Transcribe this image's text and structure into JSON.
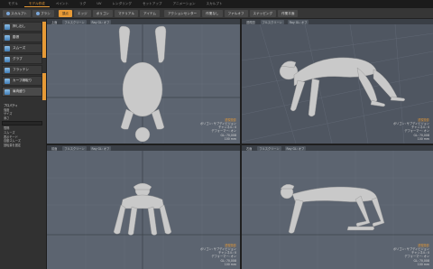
{
  "menubar": {
    "tabs": [
      "モデル",
      "モデル作成",
      "ペイント",
      "リグ",
      "UV",
      "レンダリング",
      "セットアップ",
      "アニメーション",
      "スカルプト"
    ],
    "active_index": 1
  },
  "toolbar": {
    "left_buttons": [
      "スカルプト",
      "ブラシ"
    ],
    "buttons": [
      "頂点",
      "エッジ",
      "ポリゴン",
      "マテリアル",
      "アイテム",
      "アクションセンター",
      "作業なし",
      "ファルオフ",
      "スナッピング",
      "作業平面"
    ]
  },
  "sidebar": {
    "tools": [
      "押し出し",
      "膨張",
      "スムーズ",
      "グラブ",
      "フラッテン",
      "カーブ縁取り",
      "肩肉盛り"
    ],
    "props_title": "プロパティ",
    "props_rows": [
      "強度",
      "サイズ",
      "深さ",
      "間隔",
      "スムーズ",
      "表示モード",
      "自動スムーズ",
      "回転量を固定"
    ]
  },
  "viewports": [
    {
      "name": "top",
      "hdr": [
        "上面",
        "フルスクリーン",
        "Ray GL: オフ"
      ],
      "info": [
        "透視投影",
        "ポリゴン: サブディビジョン",
        "チャンネル: 0",
        "デフォーマー: オン",
        "GL: 70,008",
        "100 mm"
      ]
    },
    {
      "name": "perspective",
      "hdr": [
        "透視図",
        "フルスクリーン",
        "Ray GL: オフ"
      ],
      "info": [
        "透視投影",
        "ポリゴン: サブディビジョン",
        "チャンネル: 0",
        "デフォーマー: オン",
        "GL: 70,008",
        "100 mm"
      ]
    },
    {
      "name": "front",
      "hdr": [
        "前面",
        "フルスクリーン",
        "Ray GL: オフ"
      ],
      "info": [
        "透視投影",
        "ポリゴン: サブディビジョン",
        "チャンネル: 0",
        "デフォーマー: オン",
        "GL: 70,008",
        "100 mm"
      ]
    },
    {
      "name": "right",
      "hdr": [
        "右面",
        "フルスクリーン",
        "Ray GL: オフ"
      ],
      "info": [
        "透視投影",
        "ポリゴン: サブディビジョン",
        "チャンネル: 0",
        "デフォーマー: オン",
        "GL: 70,008",
        "100 mm"
      ]
    }
  ],
  "colors": {
    "accent": "#e79a36",
    "viewport_bg": "#5c6470",
    "viewport_bg_persp": "#4f5661",
    "grid": "#6a727e",
    "mesh": "#c9c9c9",
    "mesh_shade": "#9d9d9d"
  }
}
